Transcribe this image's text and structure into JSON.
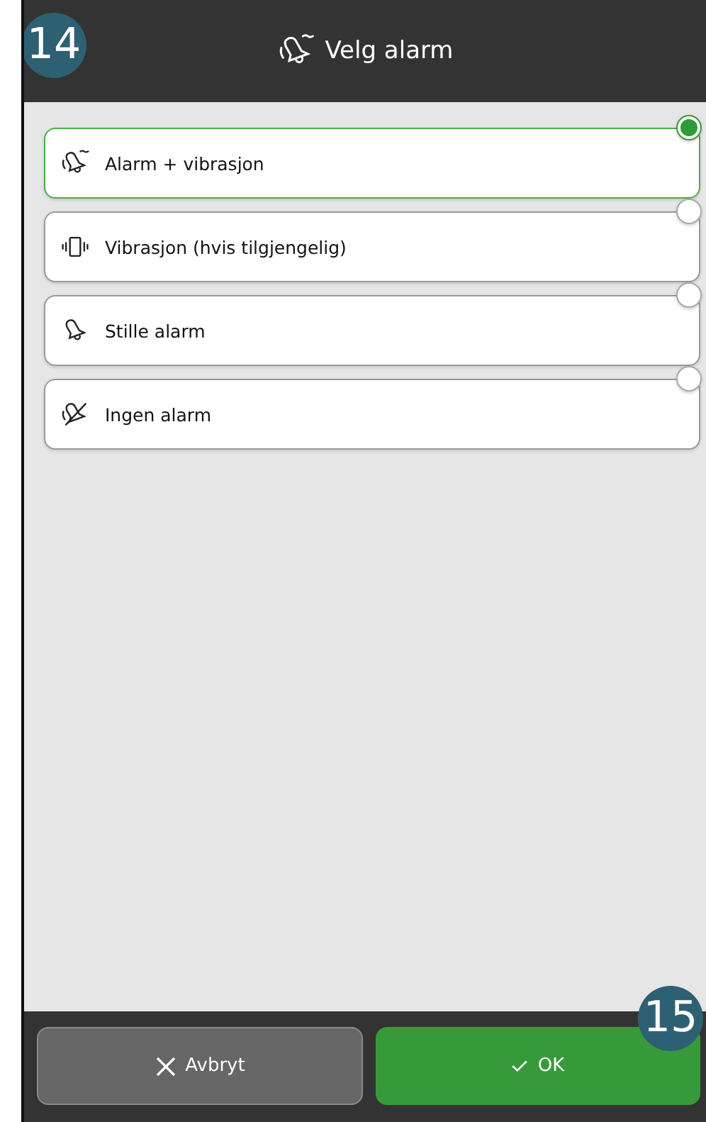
{
  "header": {
    "title": "Velg alarm",
    "badge": "14"
  },
  "options": [
    {
      "kind": "alarm-vibrate",
      "label": "Alarm + vibrasjon",
      "selected": true
    },
    {
      "kind": "vibrate",
      "label": "Vibrasjon (hvis tilgjengelig)",
      "selected": false
    },
    {
      "kind": "silent",
      "label": "Stille alarm",
      "selected": false
    },
    {
      "kind": "none",
      "label": "Ingen alarm",
      "selected": false
    }
  ],
  "footer": {
    "badge": "15",
    "buttons": [
      {
        "kind": "cancel",
        "label": "Avbryt"
      },
      {
        "kind": "ok",
        "label": "OK"
      }
    ]
  }
}
